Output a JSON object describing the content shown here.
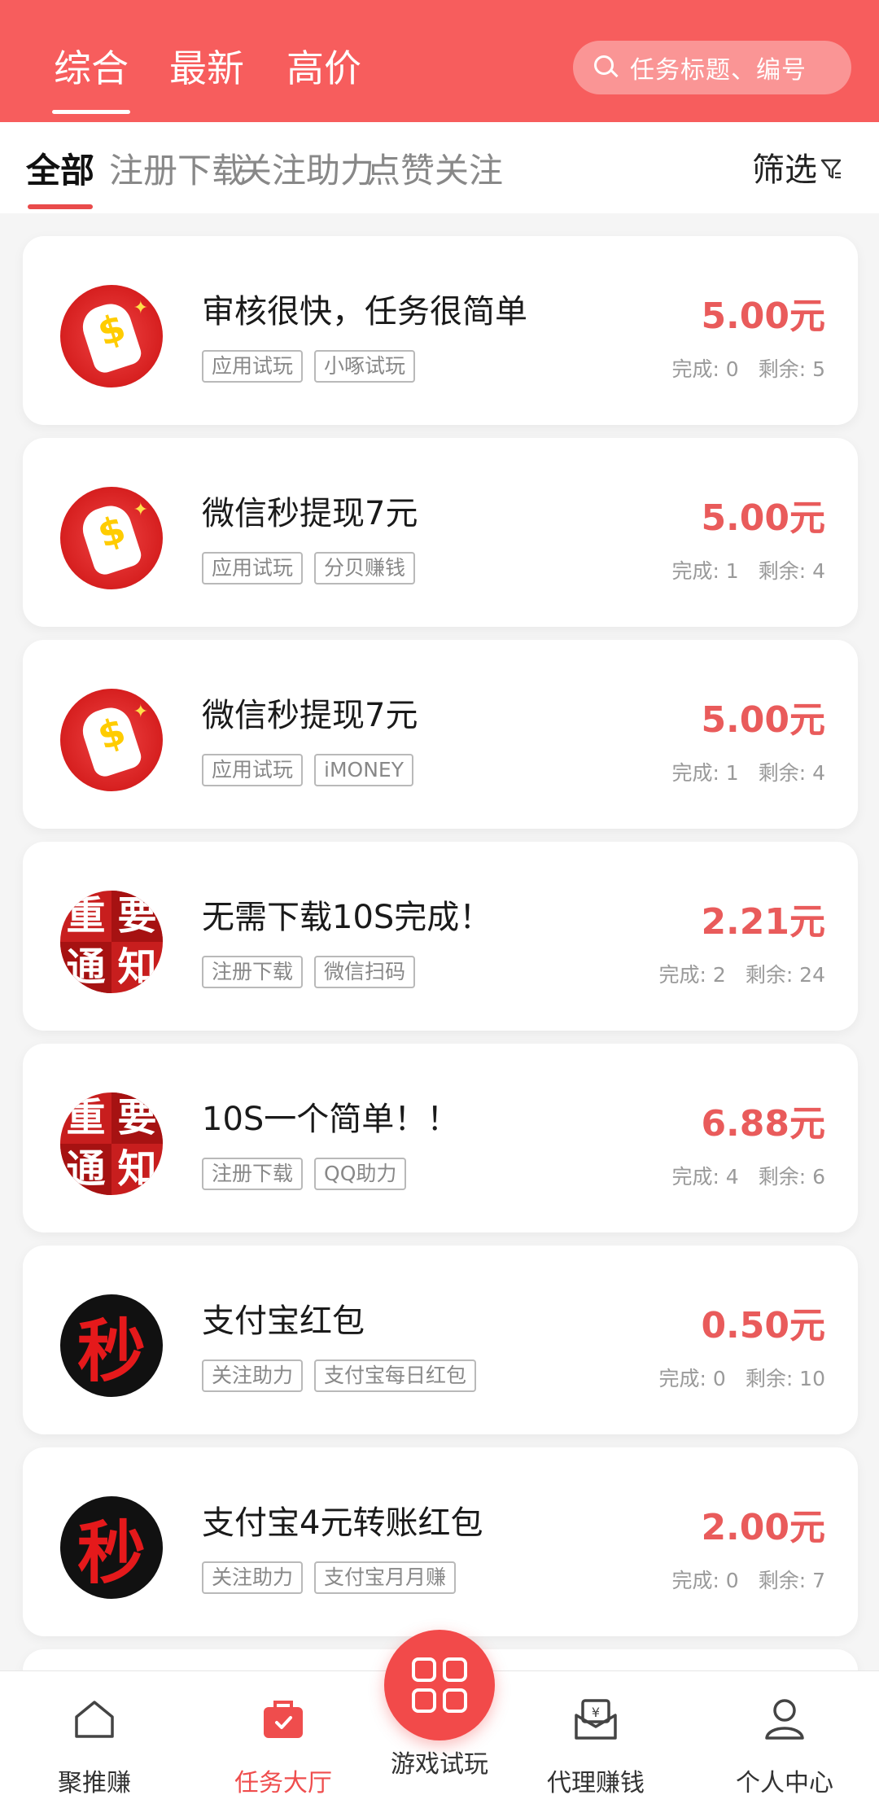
{
  "header": {
    "tabs": [
      "综合",
      "最新",
      "高价"
    ],
    "active_tab": "综合",
    "search_placeholder": "任务标题、编号"
  },
  "categories": {
    "items": [
      "全部",
      "注册下载",
      "关注助力",
      "点赞关注"
    ],
    "active": "全部",
    "filter_label": "筛选"
  },
  "tasks": [
    {
      "title": "审核很快，任务很简单",
      "tags": [
        "应用试玩",
        "小啄试玩"
      ],
      "price": "5.00元",
      "completed": "完成: 0",
      "remaining": "剩余: 5",
      "avatar": "hand-money-avatar"
    },
    {
      "title": "微信秒提现7元",
      "tags": [
        "应用试玩",
        "分贝赚钱"
      ],
      "price": "5.00元",
      "completed": "完成: 1",
      "remaining": "剩余: 4",
      "avatar": "hand-money-avatar"
    },
    {
      "title": "微信秒提现7元",
      "tags": [
        "应用试玩",
        "iMONEY"
      ],
      "price": "5.00元",
      "completed": "完成: 1",
      "remaining": "剩余: 4",
      "avatar": "hand-money-avatar"
    },
    {
      "title": "无需下载10S完成！",
      "tags": [
        "注册下载",
        "微信扫码"
      ],
      "price": "2.21元",
      "completed": "完成: 2",
      "remaining": "剩余: 24",
      "avatar": "notice-avatar"
    },
    {
      "title": "10S一个简单！！",
      "tags": [
        "注册下载",
        "QQ助力"
      ],
      "price": "6.88元",
      "completed": "完成: 4",
      "remaining": "剩余: 6",
      "avatar": "notice-avatar"
    },
    {
      "title": "支付宝红包",
      "tags": [
        "关注助力",
        "支付宝每日红包"
      ],
      "price": "0.50元",
      "completed": "完成: 0",
      "remaining": "剩余: 10",
      "avatar": "miao-avatar"
    },
    {
      "title": "支付宝4元转账红包",
      "tags": [
        "关注助力",
        "支付宝月月赚"
      ],
      "price": "2.00元",
      "completed": "完成: 0",
      "remaining": "剩余: 7",
      "avatar": "miao-avatar"
    }
  ],
  "avatar_text": {
    "notice": [
      "重",
      "要",
      "通",
      "知"
    ],
    "miao": "秒"
  },
  "bottom_nav": {
    "items": [
      {
        "label": "聚推赚",
        "icon": "home-icon"
      },
      {
        "label": "任务大厅",
        "icon": "task-bag-icon"
      },
      {
        "label": "游戏试玩",
        "icon": "grid-icon"
      },
      {
        "label": "代理赚钱",
        "icon": "envelope-yen-icon"
      },
      {
        "label": "个人中心",
        "icon": "person-icon"
      }
    ],
    "active": "任务大厅"
  },
  "colors": {
    "brand": "#f75d5d",
    "price": "#e95b5b",
    "active_nav": "#ef4d4d"
  }
}
